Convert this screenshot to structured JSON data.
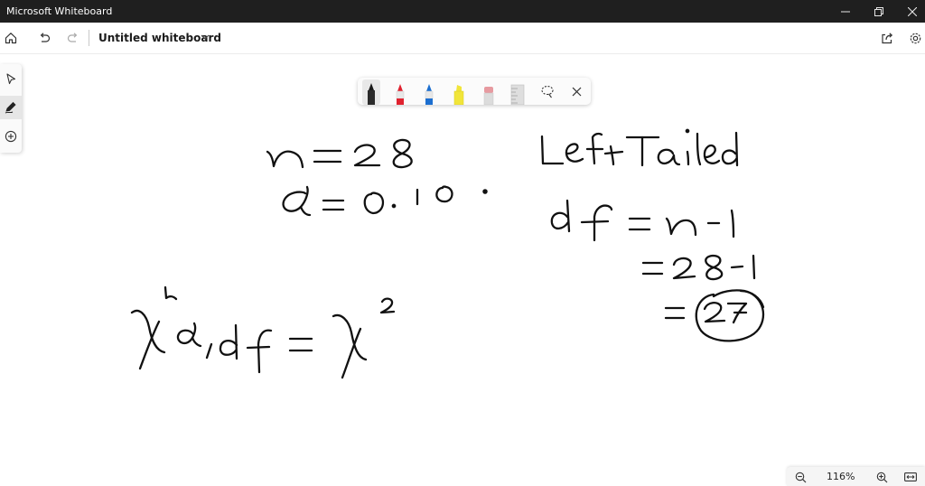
{
  "window": {
    "title": "Microsoft Whiteboard",
    "controls": [
      "minimize-icon",
      "restore-icon",
      "close-icon"
    ]
  },
  "appbar": {
    "home_icon": "home-icon",
    "undo_icon": "undo-icon",
    "redo_icon": "redo-icon",
    "document_title": "Untitled whiteboard",
    "title_menu_icon": "chevron-down-icon",
    "share_icon": "share-icon",
    "settings_icon": "gear-icon"
  },
  "left_rail": {
    "items": [
      {
        "name": "select-tool",
        "icon": "cursor-icon",
        "active": false
      },
      {
        "name": "inking-tool",
        "icon": "pen-icon",
        "active": true
      },
      {
        "name": "add-tool",
        "icon": "plus-circle-icon",
        "active": false
      }
    ]
  },
  "ink_toolbar": {
    "pens": [
      {
        "name": "black-pen",
        "color": "#1a1a1a",
        "selected": true
      },
      {
        "name": "red-pen",
        "color": "#e0222f",
        "selected": false
      },
      {
        "name": "blue-pen",
        "color": "#1c6fd0",
        "selected": false
      },
      {
        "name": "highlighter",
        "color": "#f1e53a",
        "selected": false
      },
      {
        "name": "eraser",
        "color": "#e79aa0",
        "selected": false
      },
      {
        "name": "ruler",
        "color": "#bdbdbd",
        "selected": false
      }
    ],
    "lasso_icon": "lasso-icon",
    "close_icon": "close-icon"
  },
  "zoom": {
    "level": "116%",
    "zoom_out_icon": "zoom-out-icon",
    "zoom_in_icon": "zoom-in-icon",
    "fit_icon": "fit-to-screen-icon"
  },
  "colors": {
    "titlebar": "#1f1f1f",
    "ink": "#111111",
    "canvas": "#ffffff"
  }
}
